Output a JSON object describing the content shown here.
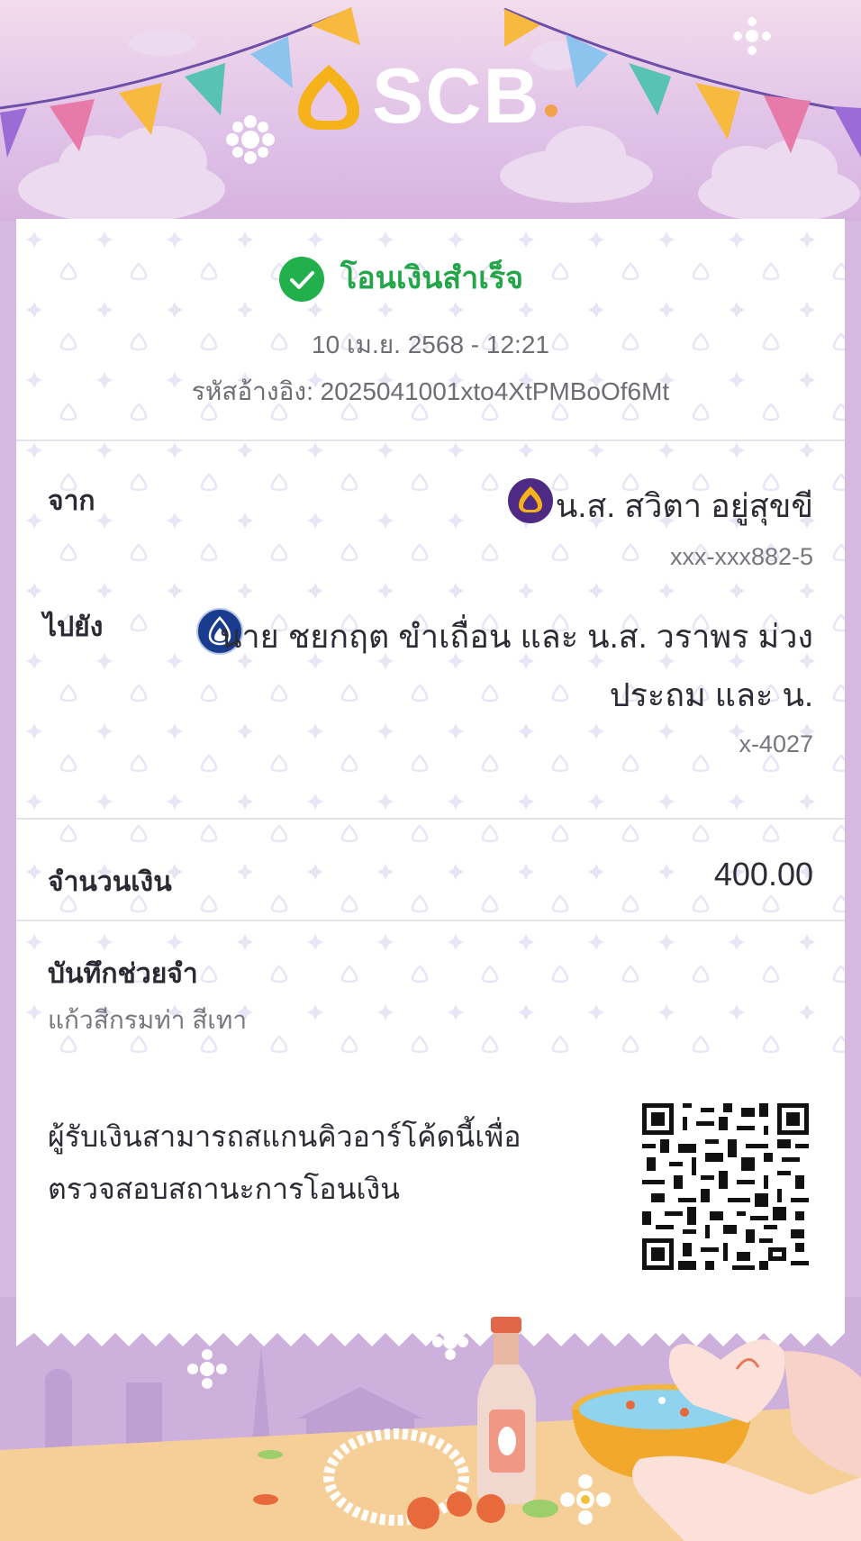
{
  "brand": {
    "name": "SCB"
  },
  "status": {
    "title": "โอนเงินสำเร็จ",
    "icon": "checkmark-icon"
  },
  "transaction": {
    "datetime": "10 เม.ย. 2568 - 12:21",
    "reference": "รหัสอ้างอิง: 2025041001xto4XtPMBoOf6Mt"
  },
  "from": {
    "label": "จาก",
    "name": "น.ส. สวิตา อยู่สุขขี",
    "account": "xxx-xxx882-5",
    "bank_icon": "scb-bank-icon"
  },
  "to": {
    "label": "ไปยัง",
    "name_line1": "นาย ชยกฤต ขำเถื่อน และ น.ส. วราพร ม่วง",
    "name_line2": "ประถม และ น.",
    "account": "x-4027",
    "bank_icon": "bangkok-bank-icon"
  },
  "amount": {
    "label": "จำนวนเงิน",
    "value": "400.00"
  },
  "memo": {
    "label": "บันทึกช่วยจำ",
    "value": "แก้วสีกรมท่า สีเทา"
  },
  "qr": {
    "line1": "ผู้รับเงินสามารถสแกนคิวอาร์โค้ดนี้เพื่อ",
    "line2": "ตรวจสอบสถานะการโอนเงิน",
    "icon": "qr-code-icon"
  },
  "colors": {
    "success": "#21b04c",
    "scb_purple": "#4e2a84",
    "bbl_blue": "#1a3c8e",
    "background": "#d7b8e0"
  }
}
